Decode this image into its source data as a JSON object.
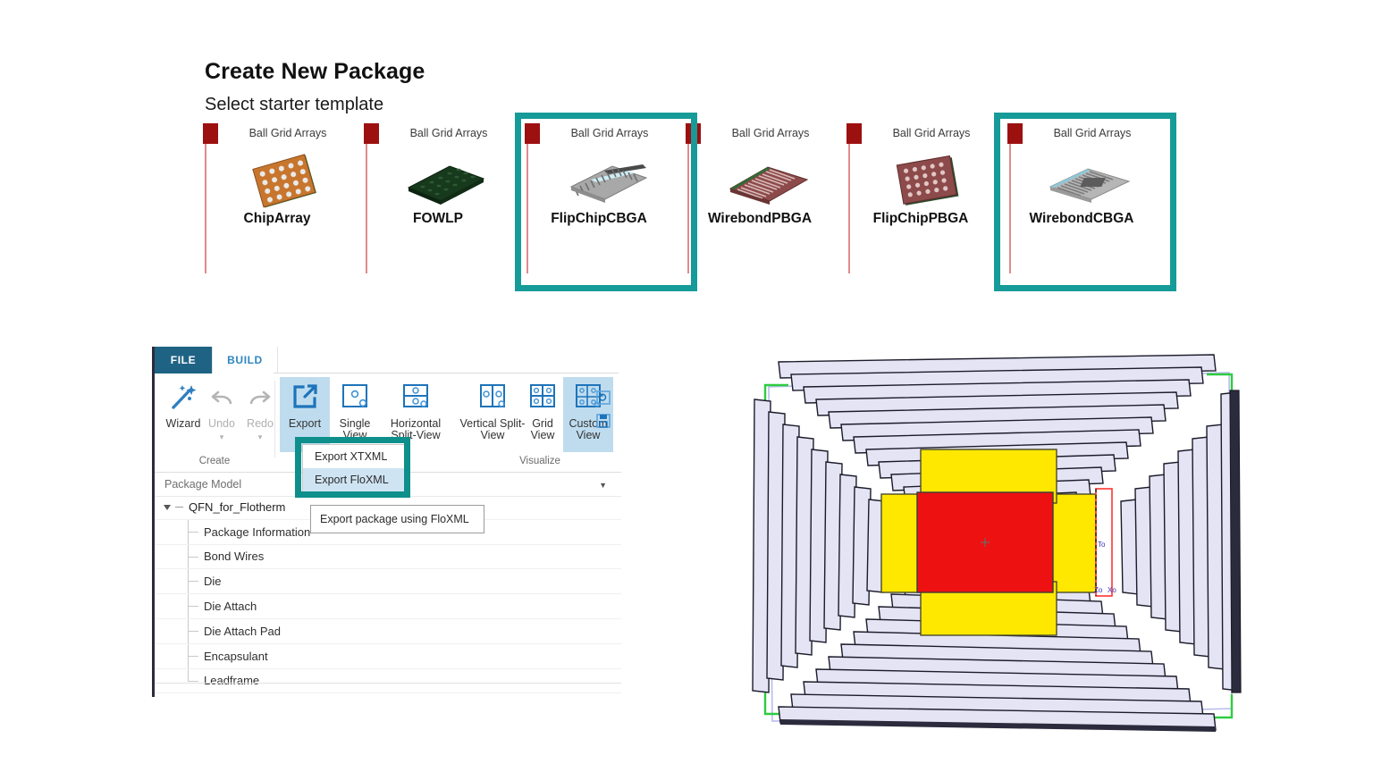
{
  "header": {
    "title": "Create New Package",
    "subtitle": "Select starter template"
  },
  "templates": [
    {
      "category": "Ball Grid Arrays",
      "name": "ChipArray",
      "icon": "chiparray-thumbnail",
      "highlighted": false
    },
    {
      "category": "Ball Grid Arrays",
      "name": "FOWLP",
      "icon": "fowlp-thumbnail",
      "highlighted": false
    },
    {
      "category": "Ball Grid Arrays",
      "name": "FlipChipCBGA",
      "icon": "flipchipcbga-thumbnail",
      "highlighted": true
    },
    {
      "category": "Ball Grid Arrays",
      "name": "WirebondPBGA",
      "icon": "wirebondpbga-thumbnail",
      "highlighted": false
    },
    {
      "category": "Ball Grid Arrays",
      "name": "FlipChipPBGA",
      "icon": "flipchippbga-thumbnail",
      "highlighted": false
    },
    {
      "category": "Ball Grid Arrays",
      "name": "WirebondCBGA",
      "icon": "wirebondcbga-thumbnail",
      "highlighted": true
    }
  ],
  "app": {
    "tabs": [
      {
        "label": "FILE",
        "active": false
      },
      {
        "label": "BUILD",
        "active": true
      }
    ],
    "ribbon": {
      "groups": [
        {
          "label": "Create",
          "buttons": [
            {
              "label": "Wizard",
              "icon": "magic-wand-icon",
              "state": "enabled"
            },
            {
              "label": "Undo",
              "icon": "undo-arrow-icon",
              "state": "disabled"
            },
            {
              "label": "Redo",
              "icon": "redo-arrow-icon",
              "state": "disabled"
            }
          ]
        },
        {
          "label": "",
          "buttons": [
            {
              "label": "Export",
              "icon": "export-arrow-icon",
              "state": "selected"
            },
            {
              "label": "Single View",
              "icon": "single-view-icon",
              "state": "enabled"
            },
            {
              "label": "Horizontal Split-View",
              "icon": "horizontal-split-view-icon",
              "state": "enabled"
            }
          ]
        },
        {
          "label": "Visualize",
          "buttons": [
            {
              "label": "Vertical Split-View",
              "icon": "vertical-split-view-icon",
              "state": "enabled"
            },
            {
              "label": "Grid View",
              "icon": "grid-view-icon",
              "state": "enabled"
            },
            {
              "label": "Custom View",
              "icon": "custom-view-icon",
              "state": "selected"
            }
          ]
        }
      ],
      "overflow_icons": [
        "restore-view-icon",
        "save-view-icon"
      ]
    },
    "export_menu": {
      "items": [
        {
          "label": "Export XTXML",
          "hovered": false
        },
        {
          "label": "Export FloXML",
          "hovered": true
        }
      ],
      "tooltip": "Export package using FloXML"
    },
    "tree_panel": {
      "header": "Package Model",
      "dropdown_icon": "chevron-down-icon",
      "root": "QFN_for_Flotherm",
      "nodes": [
        "Package Information",
        "Bond Wires",
        "Die",
        "Die Attach",
        "Die Attach Pad",
        "Encapsulant",
        "Leadframe"
      ]
    }
  },
  "viewport": {
    "name": "package-3d-preview",
    "labels": [
      "To",
      "Zo",
      "Xo"
    ],
    "parts": [
      {
        "name": "leadframe-leads",
        "color": "#e3e3f4"
      },
      {
        "name": "die-attach-pad",
        "color": "#ffe800"
      },
      {
        "name": "die",
        "color": "#ee1111"
      }
    ]
  },
  "colors": {
    "highlight_teal": "#169b98",
    "flag_red": "#9d1010",
    "file_tab_blue": "#1f6384",
    "build_tab_text": "#2e86c1",
    "ribbon_select": "#bfdcef",
    "menu_hover": "#cfe4f3"
  }
}
